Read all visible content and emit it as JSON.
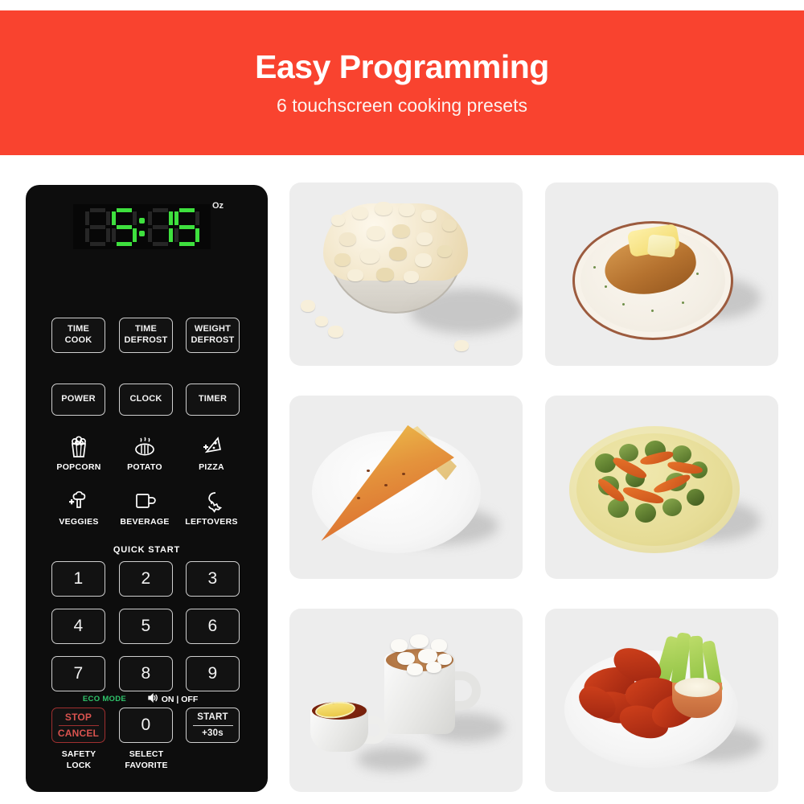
{
  "banner": {
    "title": "Easy Programming",
    "subtitle": "6 touchscreen cooking presets",
    "background_color": "#f9432f",
    "title_color": "#ffffff"
  },
  "control_panel": {
    "background_color": "#0d0d0d",
    "display": {
      "value": "5:15",
      "unit_indicator": "Oz",
      "active_color": "#3ee03e",
      "inactive_color": "#262626"
    },
    "function_keys_row1": [
      {
        "line1": "TIME",
        "line2": "COOK"
      },
      {
        "line1": "TIME",
        "line2": "DEFROST"
      },
      {
        "line1": "WEIGHT",
        "line2": "DEFROST"
      }
    ],
    "function_keys_row2": [
      {
        "line1": "POWER",
        "line2": ""
      },
      {
        "line1": "CLOCK",
        "line2": ""
      },
      {
        "line1": "TIMER",
        "line2": ""
      }
    ],
    "presets": [
      {
        "label": "POPCORN",
        "icon": "popcorn-icon"
      },
      {
        "label": "POTATO",
        "icon": "potato-icon"
      },
      {
        "label": "PIZZA",
        "icon": "pizza-icon"
      },
      {
        "label": "VEGGIES",
        "icon": "broccoli-icon"
      },
      {
        "label": "BEVERAGE",
        "icon": "mug-icon"
      },
      {
        "label": "LEFTOVERS",
        "icon": "chicken-leg-icon"
      }
    ],
    "quick_start_label": "QUICK START",
    "keypad": [
      "1",
      "2",
      "3",
      "4",
      "5",
      "6",
      "7",
      "8",
      "9"
    ],
    "eco_mode_label": "ECO MODE",
    "eco_mode_color": "#2fc46b",
    "sound_label": "ON | OFF",
    "sound_icon": "speaker-icon",
    "stop_button": {
      "line1": "STOP",
      "line2": "CANCEL",
      "color": "#d9534f"
    },
    "zero_key": "0",
    "start_button": {
      "line1": "START",
      "line2": "+30s"
    },
    "sublabels": [
      {
        "line1": "SAFETY",
        "line2": "LOCK"
      },
      {
        "line1": "SELECT",
        "line2": "FAVORITE"
      }
    ]
  },
  "food_tiles": [
    {
      "name": "popcorn-photo",
      "alt": "Bowl of popcorn with scattered kernels"
    },
    {
      "name": "baked-potato-photo",
      "alt": "Baked potato with butter on a plate"
    },
    {
      "name": "pizza-photo",
      "alt": "Slice of cheese pizza on a paper plate"
    },
    {
      "name": "roasted-vegetables-photo",
      "alt": "Roasted brussels sprouts and carrots on a yellow plate"
    },
    {
      "name": "beverages-photo",
      "alt": "Cup of tea with lemon and mug of hot cocoa with marshmallows"
    },
    {
      "name": "chicken-wings-photo",
      "alt": "Buffalo wings with celery sticks and ranch dip"
    }
  ]
}
